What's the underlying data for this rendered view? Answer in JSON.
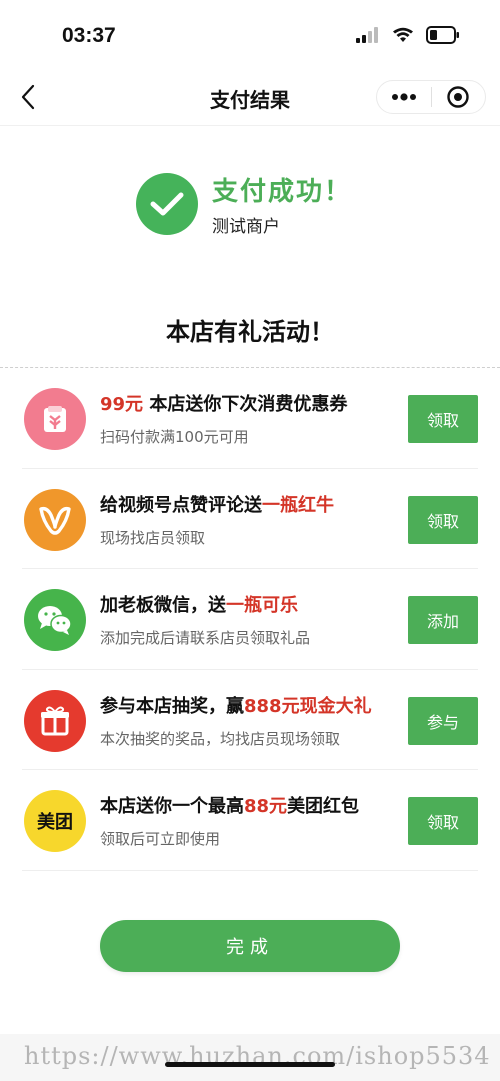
{
  "status_bar": {
    "time": "03:37"
  },
  "nav": {
    "title": "支付结果"
  },
  "result": {
    "title": "支付成功！",
    "merchant": "测试商户"
  },
  "promo": {
    "heading": "本店有礼活动！",
    "items": [
      {
        "icon": "coupon-icon",
        "title_pre": "99元",
        "title_mid": " 本店送你下次消费优惠券",
        "title_hl": "",
        "sub": "扫码付款满100元可用",
        "button": "领取",
        "color": "#f27c8f"
      },
      {
        "icon": "channels-icon",
        "title_pre": "",
        "title_mid": "给视频号点赞评论送",
        "title_hl": "一瓶红牛",
        "sub": "现场找店员领取",
        "button": "领取",
        "color": "#f0972b"
      },
      {
        "icon": "wechat-icon",
        "title_pre": "",
        "title_mid": "加老板微信，送",
        "title_hl": "一瓶可乐",
        "sub": "添加完成后请联系店员领取礼品",
        "button": "添加",
        "color": "#46b44b"
      },
      {
        "icon": "gift-icon",
        "title_pre": "",
        "title_mid": "参与本店抽奖，赢",
        "title_hl": "888元现金大礼",
        "sub": "本次抽奖的奖品，均找店员现场领取",
        "button": "参与",
        "color": "#e53a2e"
      },
      {
        "icon": "meituan-icon",
        "title_pre": "",
        "title_mid": "本店送你一个最高",
        "title_hl": "88元",
        "title_post": "美团红包",
        "sub": "领取后可立即使用",
        "button": "领取",
        "color": "#f7d72c",
        "icon_text": "美团"
      }
    ]
  },
  "done_button": "完成",
  "watermark": "https://www.huzhan.com/ishop5534"
}
